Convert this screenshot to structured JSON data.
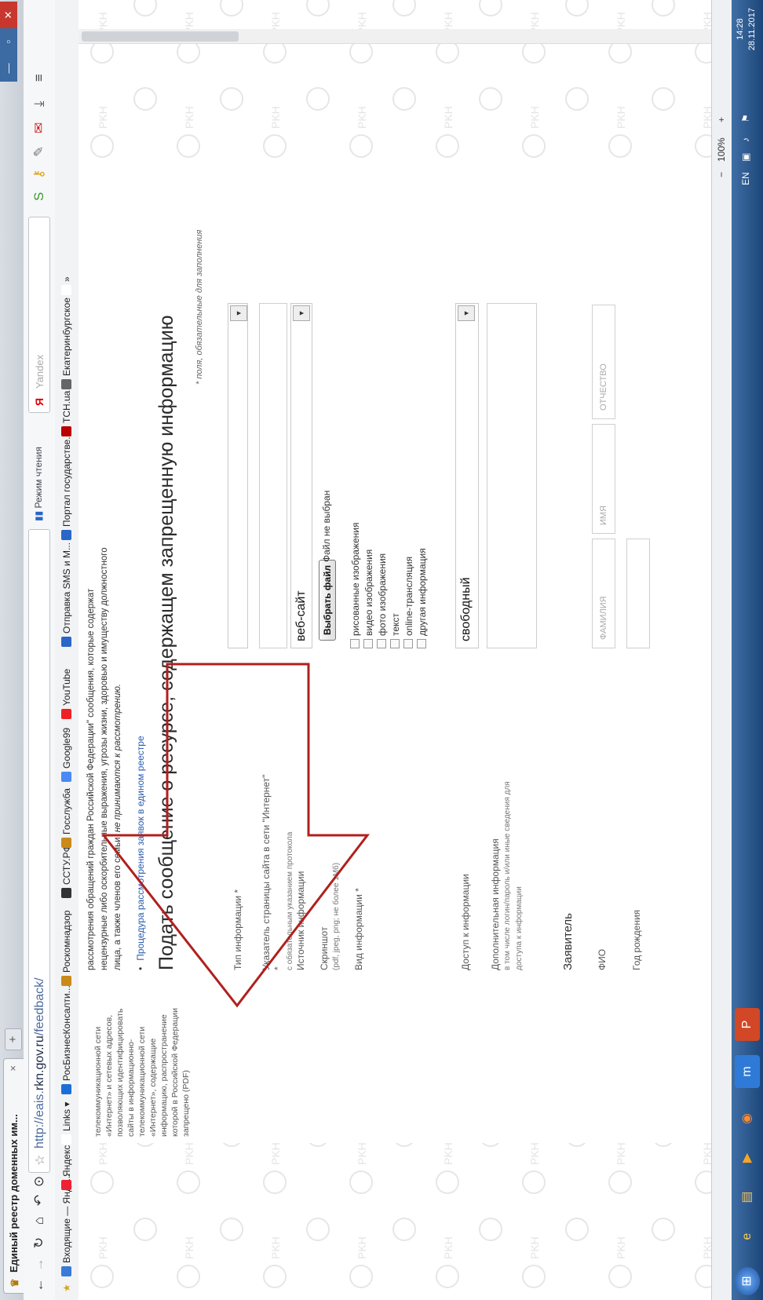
{
  "browser": {
    "tab_title": "Единый реестр доменных им...",
    "tab_close": "×",
    "new_tab": "+",
    "window_controls": [
      "—",
      "▫",
      "✕"
    ],
    "url_scheme_host": "http://eais.",
    "url_domain": "rkn.gov.ru",
    "url_path": "/feedback/",
    "reader_mode": "Режим чтения",
    "search_placeholder": "Yandex"
  },
  "bookmarks": [
    {
      "label": "Входящие — Янде...",
      "color": "#3a7bd5"
    },
    {
      "label": "Яндекс",
      "color": "#e23"
    },
    {
      "label": "Links ▾",
      "color": "#fff"
    },
    {
      "label": "РосБизнесКонсалти...",
      "color": "#1b6ed6"
    },
    {
      "label": "Роскомнадзор",
      "color": "#c98a1a"
    },
    {
      "label": "ССТУ.РФ",
      "color": "#333"
    },
    {
      "label": "Госслужба",
      "color": "#c98a1a"
    },
    {
      "label": "Google99",
      "color": "#4a8af4"
    },
    {
      "label": "YouTube",
      "color": "#e22"
    },
    {
      "label": "Отправка SMS и М...",
      "color": "#2a66c8"
    },
    {
      "label": "Портал государстве...",
      "color": "#2a66c8"
    },
    {
      "label": "ТСН.ua",
      "color": "#b00"
    },
    {
      "label": "Екатеринбургское",
      "color": "#666"
    },
    {
      "label": "»",
      "color": "#fff"
    }
  ],
  "sidebar": {
    "text": "телекоммуникационной сети «Интернет» и сетевых адресов, позволяющих идентифицировать сайты в информационно-телекоммуникационной сети «Интернет», содержащие информацию, распространение которой в Российской Федерации запрещено (PDF)"
  },
  "intro": {
    "line1": "рассмотрения обращений граждан Российской Федерации\" сообщения, которые содержат",
    "line2": "нецензурные либо оскорбительные выражения, угрозы жизни, здоровью и имуществу должностного",
    "line3": "лица, а также членов его семьи,",
    "line3_em": "не принимаются к рассмотрению.",
    "bullet": "•",
    "procedure_link": "Процедура рассмотрения заявок в едином реестре"
  },
  "form": {
    "title": "Подать сообщение о ресурсе, содержащем запрещенную информацию",
    "required_note": "* поля, обязательные для заполнения",
    "info_type_label": "Тип информации *",
    "url_label": "Указатель страницы сайта в сети \"Интернет\" *",
    "url_hint": "с обязательным указанием протокола",
    "source_label": "Источник информации",
    "source_value": "веб-сайт",
    "screenshot_label": "Скриншот",
    "screenshot_hint": "(pdf, jpeg, png; не более 1Мб)",
    "file_button": "Выбрать файл",
    "file_status": "Файл не выбран",
    "kind_label": "Вид информации *",
    "kinds": [
      "рисованные изображения",
      "видео изображения",
      "фото изображения",
      "текст",
      "online-трансляция",
      "другая информация"
    ],
    "access_label": "Доступ к информации",
    "access_value": "свободный",
    "extra_label": "Дополнительная информация",
    "extra_hint": "в том числе логин/пароль и/или иные сведения для доступа к информации",
    "applicant_heading": "Заявитель",
    "fio_label": "ФИО",
    "surname_ph": "фамилия",
    "name_ph": "имя",
    "patronymic_ph": "отчество",
    "birth_label": "Год рождения"
  },
  "status": {
    "zoom": "100%",
    "minus": "−",
    "plus": "+"
  },
  "taskbar": {
    "lang": "EN",
    "time": "14:28",
    "date": "28.11.2017"
  },
  "colors": {
    "annotation_arrow": "#b0201e",
    "link": "#2a5db0",
    "taskbar": "#1d4679"
  }
}
